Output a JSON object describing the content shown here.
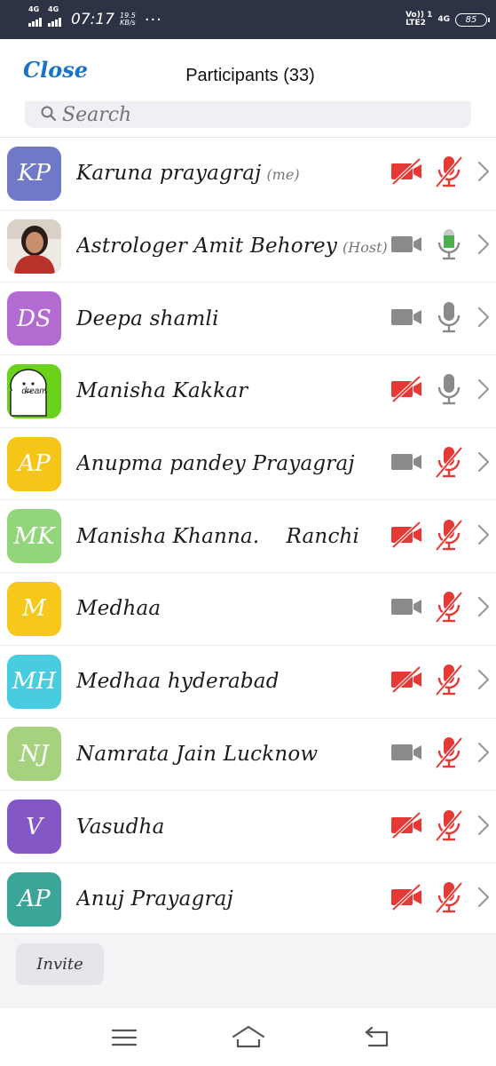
{
  "status_bar": {
    "sim1": "4G",
    "sim2": "4G",
    "time": "07:17",
    "speed_value": "19.5",
    "speed_unit": "KB/s",
    "overflow": "···",
    "volte_top": "Vo)) 1",
    "volte_bottom": "LTE2",
    "network_right": "4G",
    "battery": "85"
  },
  "header": {
    "close_label": "Close",
    "title": "Participants (33)"
  },
  "search": {
    "placeholder": "Search"
  },
  "colors": {
    "accent": "#1a73c8",
    "muted_red": "#e53935",
    "icon_gray": "#8a8a8a",
    "mic_green": "#4caf50"
  },
  "participants": [
    {
      "initials": "KP",
      "name": "Karuna prayagraj",
      "tag": "(me)",
      "avatar_color": "#6f79c8",
      "video": "off",
      "audio": "muted"
    },
    {
      "initials": "",
      "name": "Astrologer Amit Behorey",
      "tag": "(Host)",
      "avatar_color": "#8c3a35",
      "avatar_image": "photo",
      "video": "on",
      "audio": "speaking"
    },
    {
      "initials": "DS",
      "name": "Deepa shamli",
      "tag": "",
      "avatar_color": "#b36bd1",
      "video": "on",
      "audio": "on"
    },
    {
      "initials": "",
      "name": "Manisha Kakkar",
      "tag": "",
      "avatar_color": "#6ad21b",
      "avatar_image": "dream-sticker",
      "avatar_text": "dream",
      "video": "off",
      "audio": "on"
    },
    {
      "initials": "AP",
      "name": "Anupma pandey Prayagraj",
      "tag": "",
      "avatar_color": "#f5c518",
      "video": "on",
      "audio": "muted"
    },
    {
      "initials": "MK",
      "name": "Manisha Khanna.    Ranchi",
      "tag": "",
      "avatar_color": "#93d57a",
      "video": "off",
      "audio": "muted"
    },
    {
      "initials": "M",
      "name": "Medhaa",
      "tag": "",
      "avatar_color": "#f7c81b",
      "video": "on",
      "audio": "muted"
    },
    {
      "initials": "MH",
      "name": "Medhaa hyderabad",
      "tag": "",
      "avatar_color": "#48cde0",
      "video": "off",
      "audio": "muted"
    },
    {
      "initials": "NJ",
      "name": "Namrata Jain Lucknow",
      "tag": "",
      "avatar_color": "#a6d27f",
      "video": "on",
      "audio": "muted"
    },
    {
      "initials": "V",
      "name": "Vasudha",
      "tag": "",
      "avatar_color": "#8457c7",
      "video": "off",
      "audio": "muted"
    },
    {
      "initials": "AP",
      "name": "Anuj Prayagraj",
      "tag": "",
      "avatar_color": "#3ca59a",
      "video": "off",
      "audio": "muted"
    }
  ],
  "footer": {
    "invite_label": "Invite"
  },
  "nav": {
    "menu_icon": "menu-icon",
    "home_icon": "home-icon",
    "back_icon": "back-icon"
  }
}
